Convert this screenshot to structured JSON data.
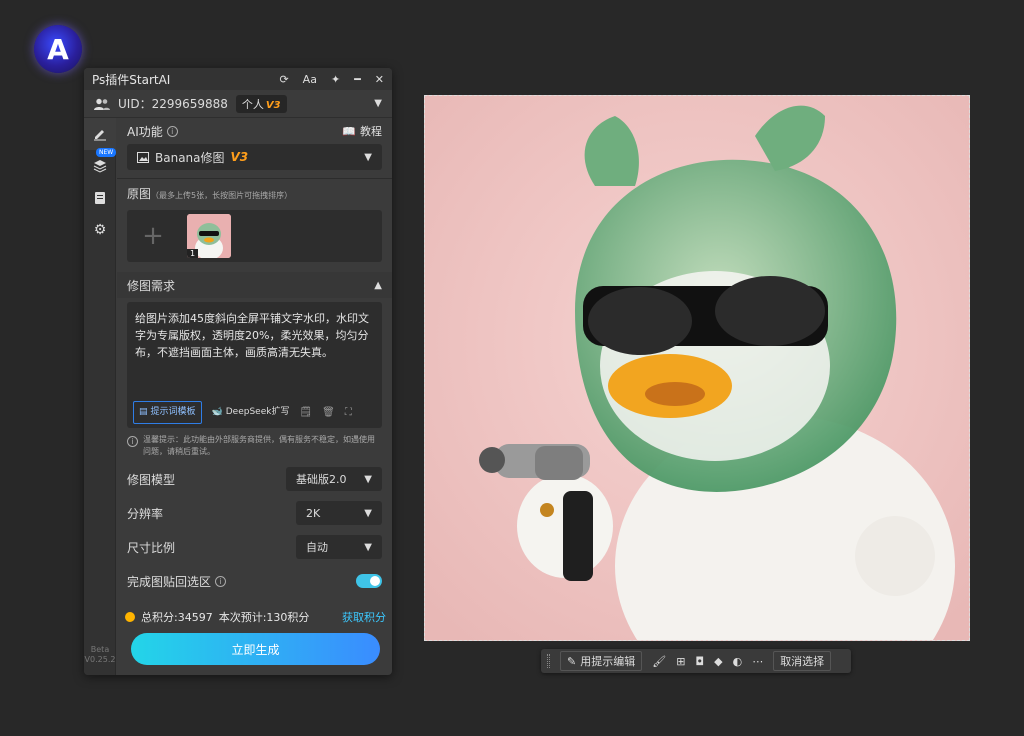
{
  "app": {
    "title": "Ps插件StartAI",
    "logo_letter": "A",
    "uid_label": "UID：2299659888",
    "plan_label": "个人",
    "plan_version": "V3",
    "beta_label": "Beta",
    "version": "V0.25.2"
  },
  "titlebar_icons": [
    "refresh-icon",
    "font-size-icon",
    "pin-icon",
    "minimize-icon",
    "close-icon"
  ],
  "sidebar": {
    "items": [
      {
        "icon": "edit-icon",
        "active": true
      },
      {
        "icon": "layers-icon",
        "badge": "NEW"
      },
      {
        "icon": "document-icon"
      },
      {
        "icon": "gear-icon"
      }
    ]
  },
  "ai_function": {
    "label": "AI功能",
    "tutorial_label": "教程",
    "selected": "Banana修图",
    "selected_version": "V3"
  },
  "source": {
    "label": "原图",
    "hint": "（最多上传5张，长按图片可拖拽排序）",
    "add_symbol": "+",
    "thumb_index": "1"
  },
  "requirements": {
    "label": "修图需求",
    "prompt_text": "给图片添加45度斜向全屏平铺文字水印，水印文字为专属版权，透明度20%，柔光效果，均匀分布，不遮挡画面主体，画质高清无失真。",
    "template_button": "提示词模板",
    "deepseek_button": "DeepSeek扩写",
    "tip": "温馨提示：此功能由外部服务商提供，偶有服务不稳定，如遇使用问题，请稍后重试。"
  },
  "options": {
    "model_label": "修图模型",
    "model_value": "基础版2.0",
    "resolution_label": "分辨率",
    "resolution_value": "2K",
    "ratio_label": "尺寸比例",
    "ratio_value": "自动",
    "paste_label": "完成图贴回选区",
    "paste_enabled": true
  },
  "credits": {
    "total": "总积分:34597",
    "estimate": "本次预计:130积分",
    "get_label": "获取积分"
  },
  "generate_button": "立即生成",
  "floating_toolbar": {
    "prompt_edit_label": "用提示编辑",
    "icons": [
      "brush-icon",
      "expand-icon",
      "mask-icon",
      "fill-icon",
      "contrast-icon",
      "more-icon"
    ],
    "cancel_label": "取消选择"
  },
  "colors": {
    "accent_cyan": "#23d5e8",
    "accent_blue": "#3a8cff",
    "canvas_bg": "#efc6c4",
    "version_orange": "#ff9e1b"
  }
}
